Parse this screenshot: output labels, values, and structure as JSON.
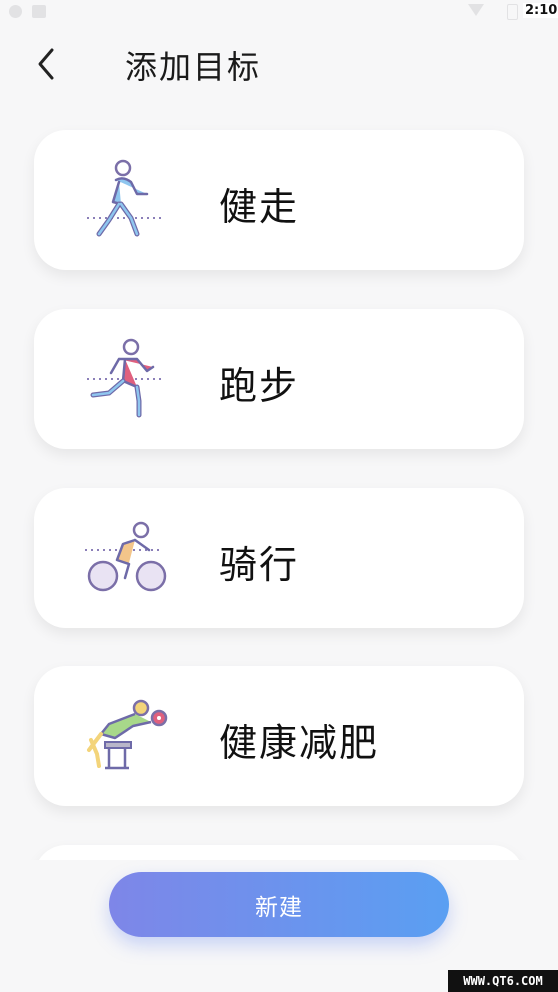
{
  "status_bar": {
    "time": "2:10"
  },
  "header": {
    "title": "添加目标"
  },
  "goals": [
    {
      "label": "健走",
      "icon": "walking-person-icon"
    },
    {
      "label": "跑步",
      "icon": "running-person-icon"
    },
    {
      "label": "骑行",
      "icon": "cycling-person-icon"
    },
    {
      "label": "健康减肥",
      "icon": "weight-training-icon"
    }
  ],
  "actions": {
    "new_label": "新建"
  },
  "watermark": "WWW.QT6.COM",
  "colors": {
    "button_start": "#7e86e8",
    "button_end": "#5a9ff2",
    "background": "#f7f7f8"
  }
}
